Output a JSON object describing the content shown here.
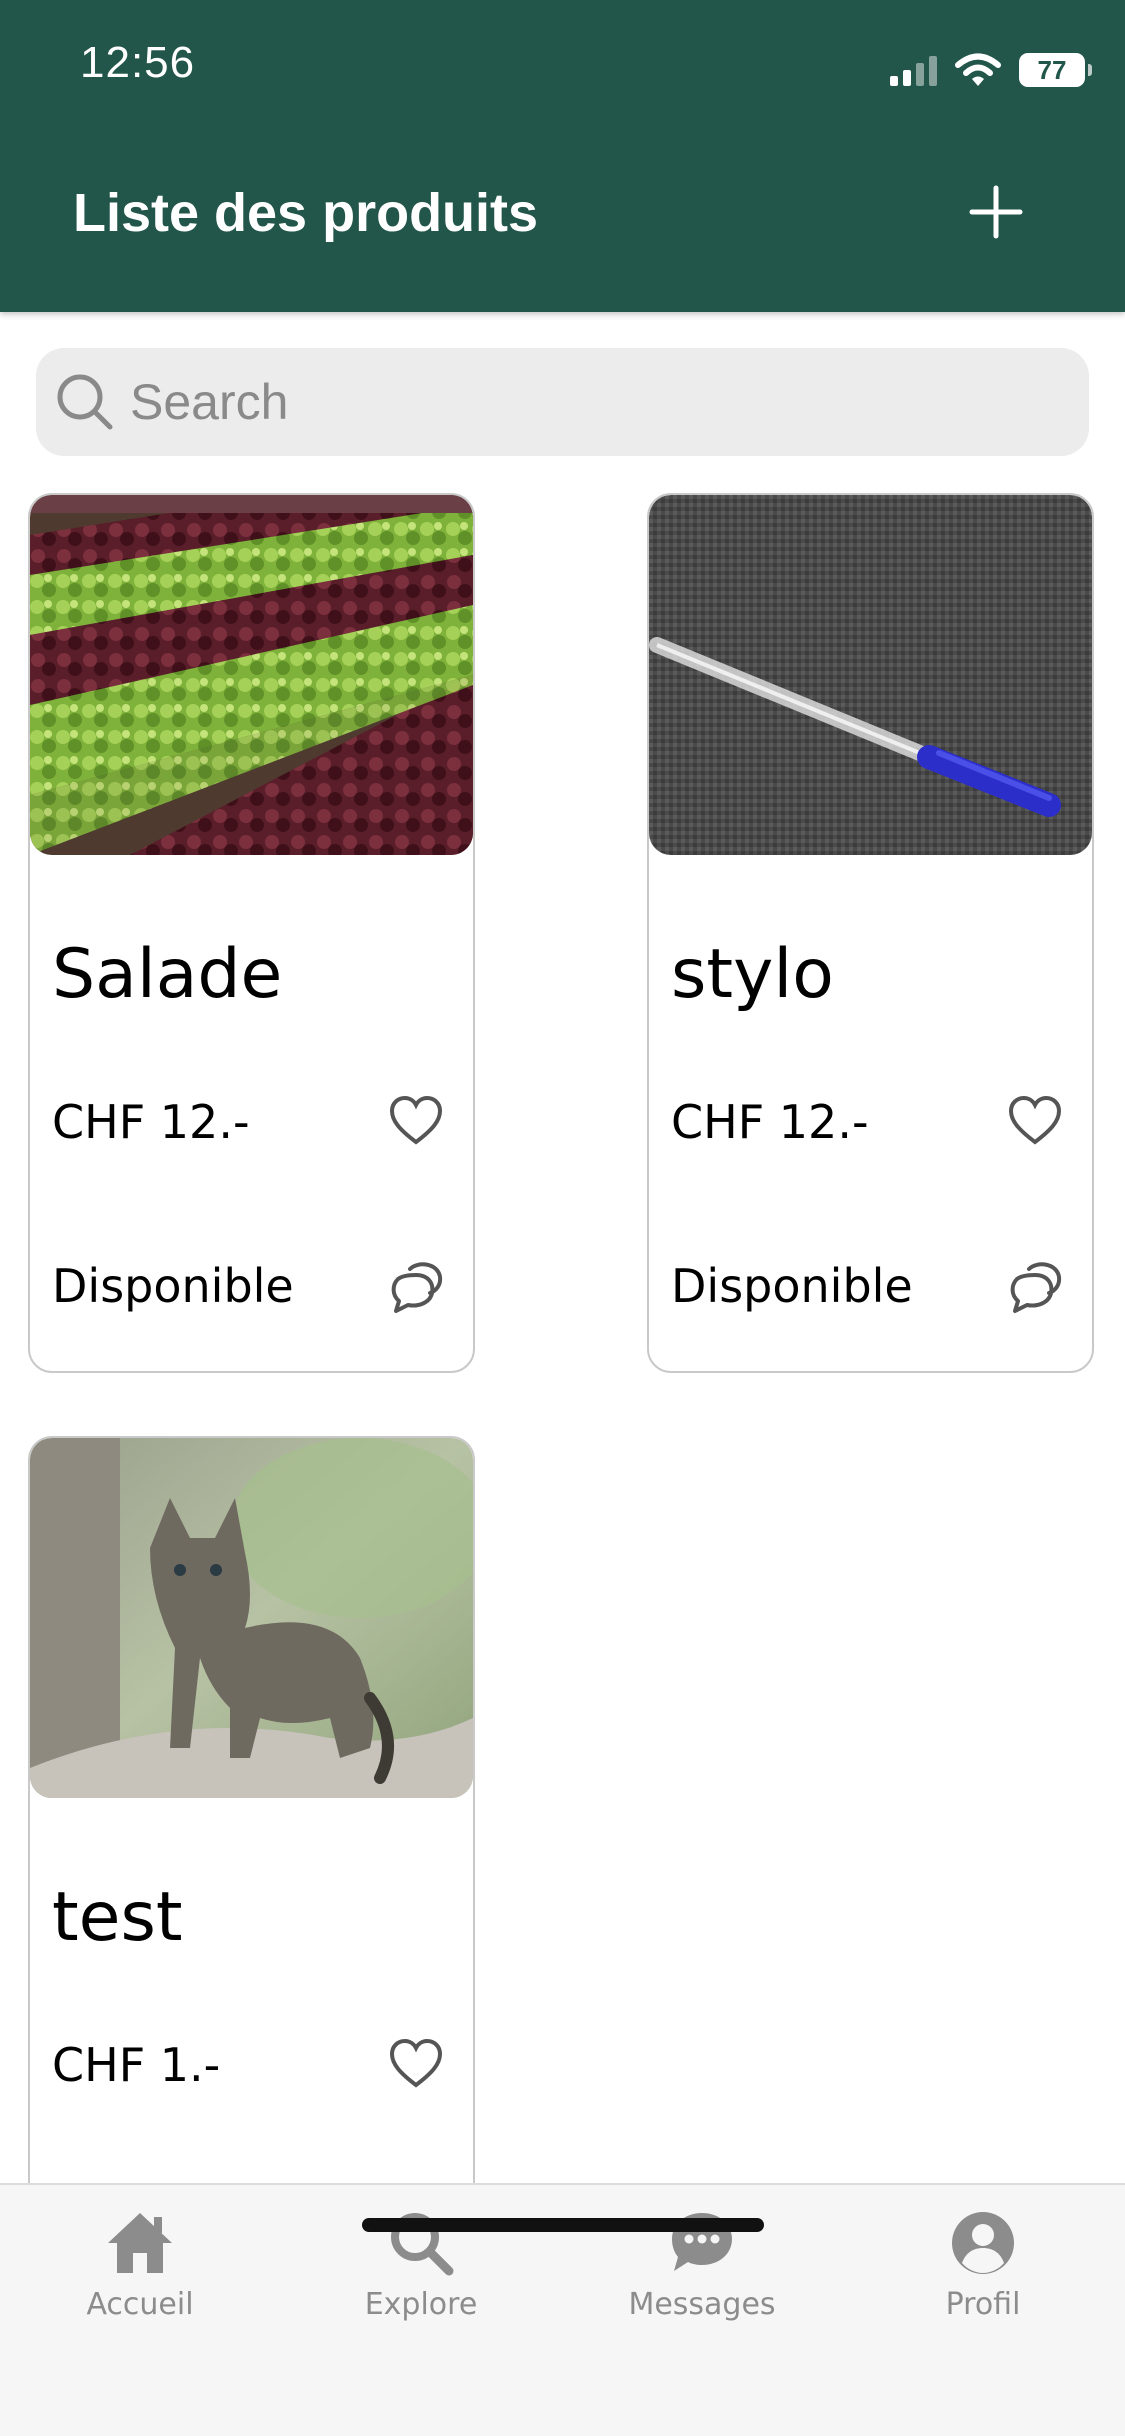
{
  "status_bar": {
    "time": "12:56",
    "battery": "77"
  },
  "header": {
    "title": "Liste des produits",
    "add_icon": "plus-icon"
  },
  "search": {
    "placeholder": "Search"
  },
  "products": [
    {
      "name": "Salade",
      "price": "CHF 12.-",
      "status": "Disponible",
      "image": "lettuce-field-photo"
    },
    {
      "name": "stylo",
      "price": "CHF 12.-",
      "status": "Disponible",
      "image": "blue-pen-on-fabric-photo"
    },
    {
      "name": "test",
      "price": "CHF 1.-",
      "status": "",
      "image": "kitten-photo"
    }
  ],
  "tabbar": {
    "items": [
      {
        "label": "Accueil",
        "icon": "home-icon"
      },
      {
        "label": "Explore",
        "icon": "search-icon"
      },
      {
        "label": "Messages",
        "icon": "chat-bubble-icon"
      },
      {
        "label": "Profil",
        "icon": "user-icon"
      }
    ]
  },
  "colors": {
    "header": "#23564a",
    "tab_label": "#8c8c8c",
    "search_bg": "#ececec"
  }
}
